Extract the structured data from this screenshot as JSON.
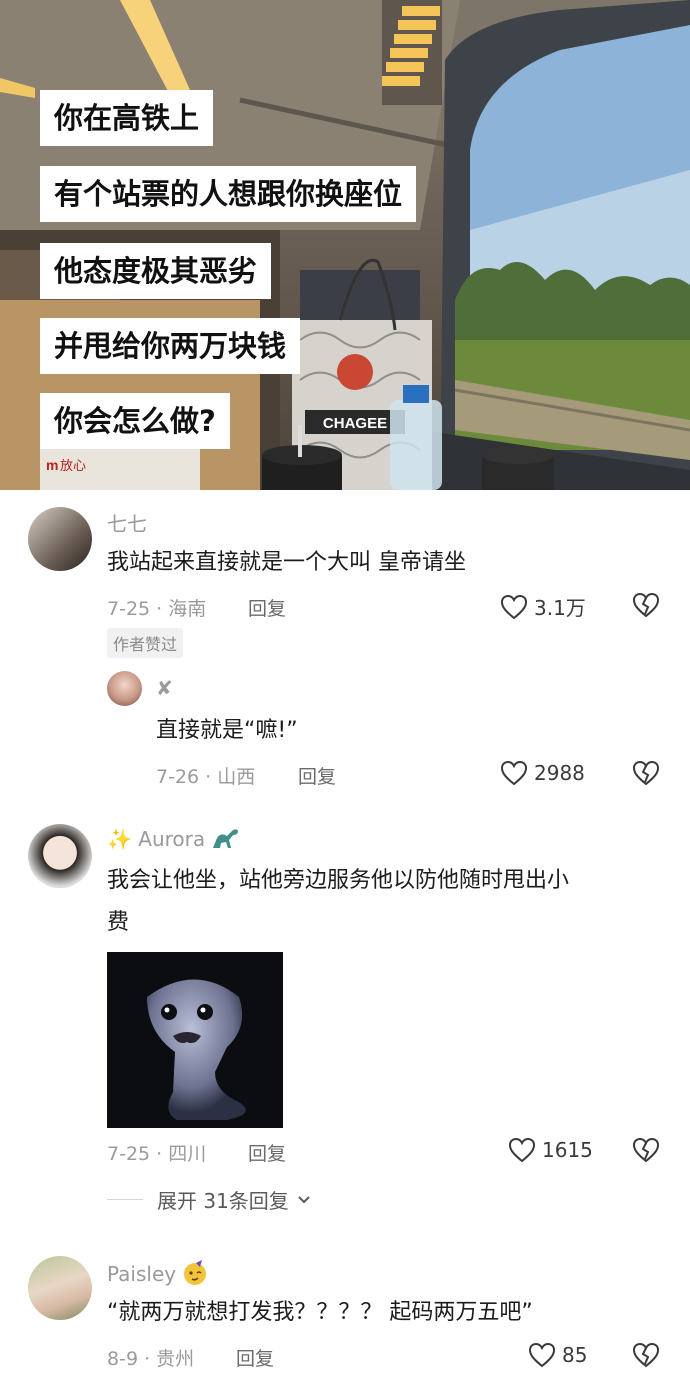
{
  "hero": {
    "captions": [
      "你在高铁上",
      "有个站票的人想跟你换座位",
      "他态度极其恶劣",
      "并甩给你两万块钱",
      "你会怎么做?"
    ],
    "bag_brand": "CHAGEE",
    "bag_logo_text": "放心"
  },
  "comments": [
    {
      "user": "七七",
      "text": "我站起来直接就是一个大叫 皇帝请坐",
      "meta": "7-25 · 海南",
      "reply": "回复",
      "likes": "3.1万",
      "badge": "作者赞过"
    },
    {
      "user": "✘",
      "text": "直接就是“嗻!”",
      "meta": "7-26 · 山西",
      "reply": "回复",
      "likes": "2988"
    },
    {
      "user": "✨ Aurora",
      "text_line1": "我会让他坐，站他旁边服务他以防他随时甩出小",
      "text_line2": "费",
      "meta": "7-25 · 四川",
      "reply": "回复",
      "likes": "1615",
      "expand": "展开 31条回复"
    },
    {
      "user": "Paisley",
      "text": "“就两万就想打发我？？？？ 起码两万五吧”",
      "meta": "8-9 · 贵州",
      "reply": "回复",
      "likes": "85"
    }
  ],
  "colors": {
    "meta": "#9b9b9b",
    "caption_bg": "#ffffff"
  }
}
